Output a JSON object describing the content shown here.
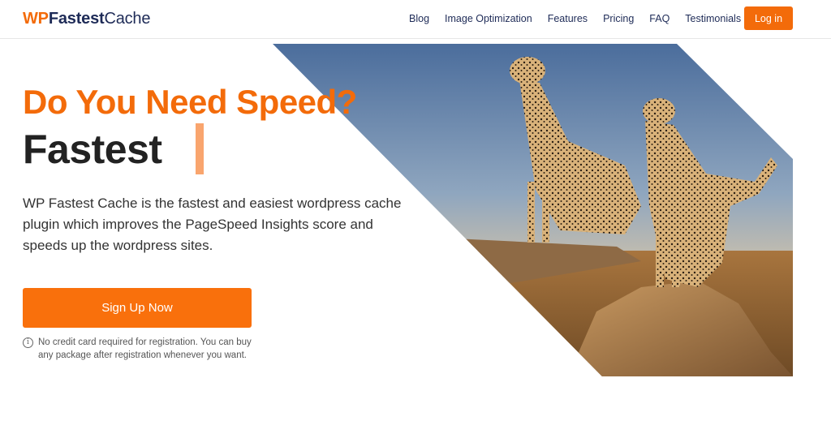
{
  "brand": {
    "wp": "WP",
    "fastest": "Fastest",
    "cache": "Cache"
  },
  "nav": {
    "items": [
      "Blog",
      "Image Optimization",
      "Features",
      "Pricing",
      "FAQ",
      "Testimonials"
    ],
    "login_label": "Log in"
  },
  "hero": {
    "headline": "Do You Need Speed?",
    "subheadline": "Fastest",
    "description": "WP Fastest Cache is the fastest and easiest wordpress cache plugin which improves the PageSpeed Insights score and speeds up the wordpress sites.",
    "cta_label": "Sign Up Now",
    "note": "No credit card required for registration. You can buy any package after registration whenever you want.",
    "image_subject": "cheetahs"
  },
  "colors": {
    "accent": "#f36b0a",
    "brand_navy": "#1e2b57",
    "cursor": "#f9a56e"
  }
}
